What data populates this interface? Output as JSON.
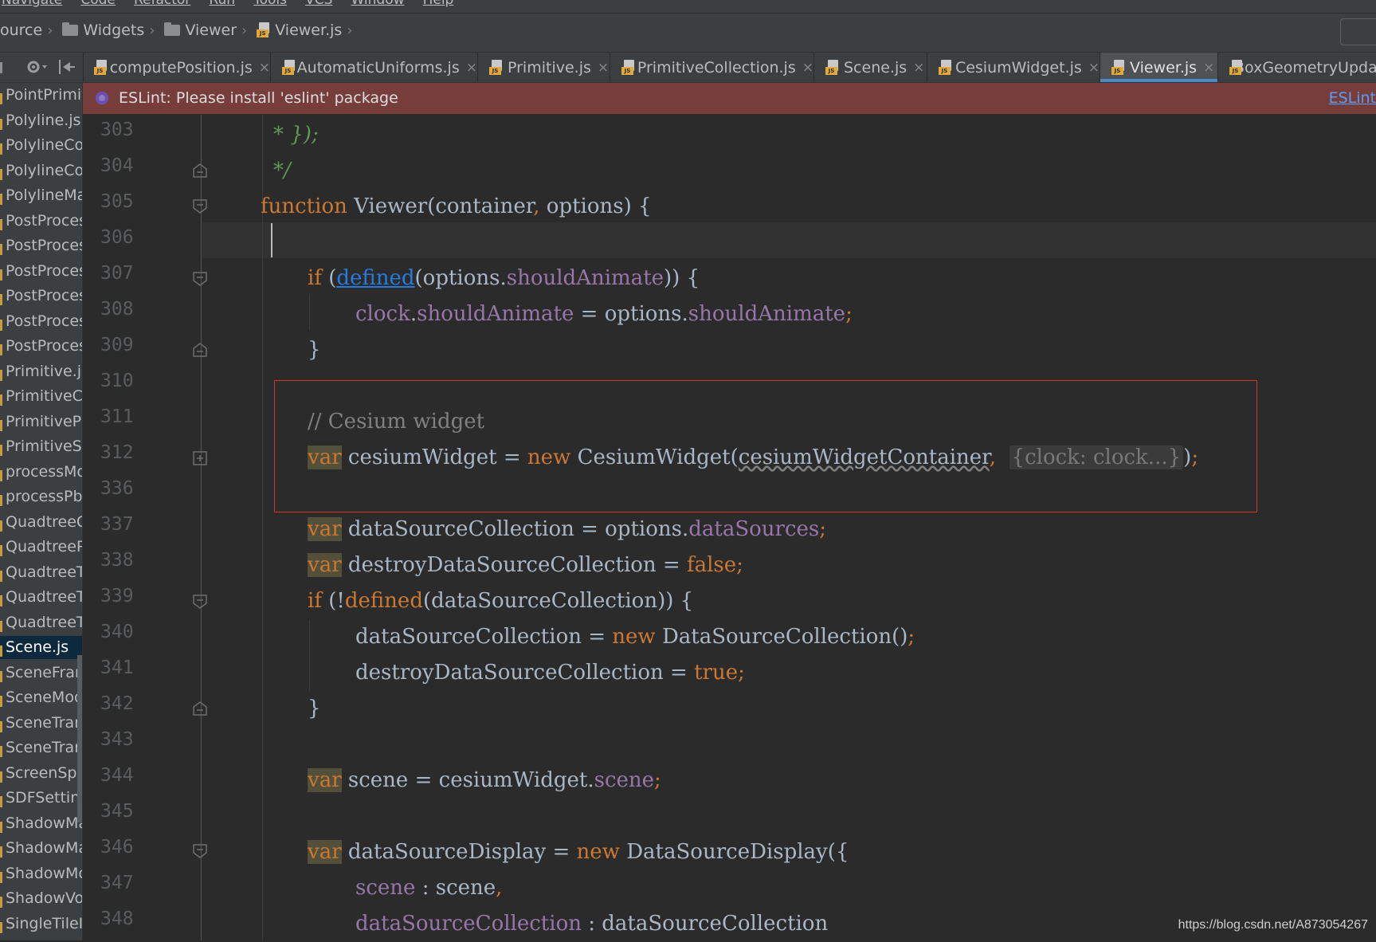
{
  "menubar": {
    "items": [
      "Navigate",
      "Code",
      "Refactor",
      "Run",
      "Tools",
      "VCS",
      "Window",
      "Help"
    ]
  },
  "breadcrumb": {
    "items": [
      "ource",
      "Widgets",
      "Viewer",
      "Viewer.js"
    ]
  },
  "tabs": [
    {
      "label": "computePosition.js"
    },
    {
      "label": "AutomaticUniforms.js"
    },
    {
      "label": "Primitive.js"
    },
    {
      "label": "PrimitiveCollection.js"
    },
    {
      "label": "Scene.js"
    },
    {
      "label": "CesiumWidget.js"
    },
    {
      "label": "Viewer.js",
      "active": true
    },
    {
      "label": "BoxGeometryUpda"
    }
  ],
  "sidebar": {
    "items": [
      "PointPrimit",
      "Polyline.js",
      "PolylineCol",
      "PolylineCol",
      "PolylineMa",
      "PostProces",
      "PostProces",
      "PostProces",
      "PostProces",
      "PostProces",
      "PostProces",
      "Primitive.js",
      "PrimitiveCo",
      "PrimitivePi",
      "PrimitiveSt",
      "processMo",
      "processPbr",
      "QuadtreeO",
      "QuadtreeP",
      "QuadtreeTi",
      "QuadtreeTi",
      "QuadtreeTi",
      "Scene.js",
      "SceneFram",
      "SceneMode",
      "SceneTrans",
      "SceneTrans",
      "ScreenSpac",
      "SDFSetting",
      "ShadowMa",
      "ShadowMa",
      "ShadowMo",
      "ShadowVol",
      "SingleTileIr"
    ],
    "selected_index": 22
  },
  "notification": {
    "message": "ESLint: Please install 'eslint' package",
    "link": "ESLint"
  },
  "editor": {
    "line_numbers": [
      "303",
      "304",
      "305",
      "306",
      "307",
      "308",
      "309",
      "310",
      "311",
      "312",
      "336",
      "337",
      "338",
      "339",
      "340",
      "341",
      "342",
      "343",
      "344",
      "345",
      "346",
      "347",
      "348"
    ],
    "current_line": "306"
  },
  "watermark": "https://blog.csdn.net/A873054267",
  "colors": {
    "keyword": "#cc7832",
    "property": "#9876aa",
    "comment": "#808080",
    "jsdoc": "#629755",
    "highlight_box": "#d6332b",
    "notification_bg": "#763d3b"
  }
}
